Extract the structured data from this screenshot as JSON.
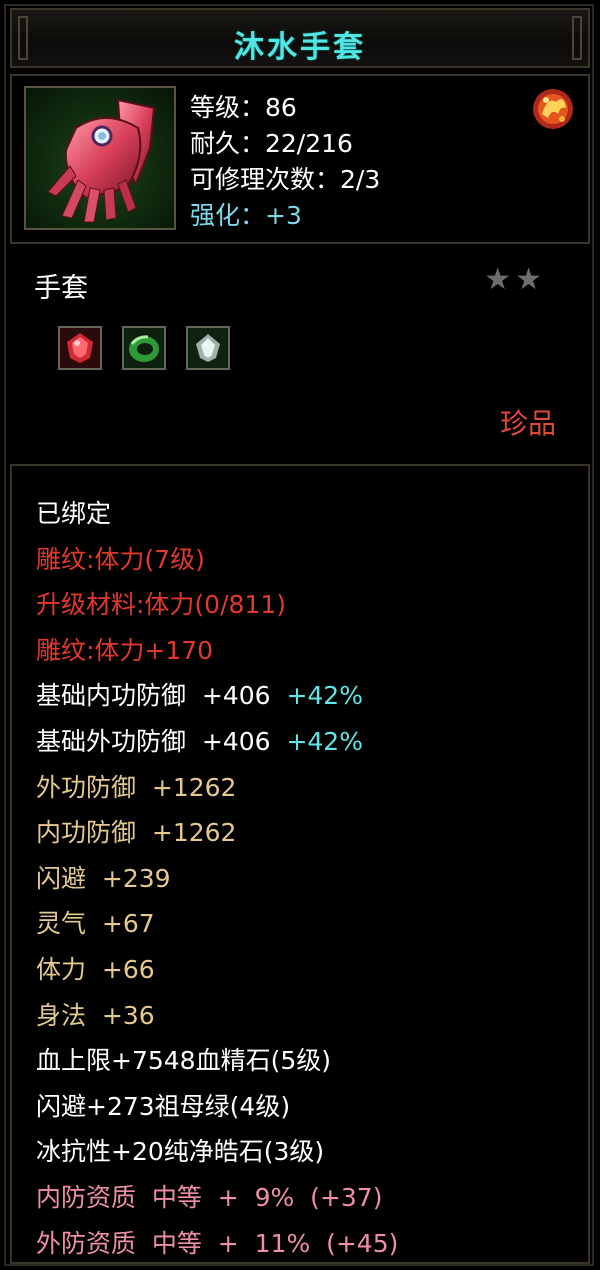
{
  "item": {
    "name": "沐水手套",
    "info": {
      "level": "等级：86",
      "durability": "耐久：22/216",
      "repair": "可修理次数：2/3",
      "enhance": "强化：+3"
    },
    "type": "手套",
    "stars": "★★",
    "rarity": "珍品",
    "icons": {
      "item": "red-gauntlet-icon",
      "emblem": "flame-emblem-icon",
      "gems": [
        "red-gem-icon",
        "green-jade-icon",
        "white-diamond-icon"
      ]
    }
  },
  "stats": [
    {
      "text": "已绑定",
      "color": "#ffffff"
    },
    {
      "text": "雕纹:体力(7级)",
      "color": "#e0392c"
    },
    {
      "text": "升级材料:体力(0/811)",
      "color": "#e0392c"
    },
    {
      "text": "雕纹:体力+170",
      "color": "#e0392c"
    },
    {
      "text": "基础内功防御  +406",
      "extra": "+42%",
      "color": "#ffffff"
    },
    {
      "text": "基础外功防御  +406",
      "extra": "+42%",
      "color": "#ffffff"
    },
    {
      "text": "外功防御  +1262",
      "color": "#e3c98d"
    },
    {
      "text": "内功防御  +1262",
      "color": "#e3c98d"
    },
    {
      "text": "闪避  +239",
      "color": "#e3c98d"
    },
    {
      "text": "灵气  +67",
      "color": "#e3c98d"
    },
    {
      "text": "体力  +66",
      "color": "#e3c98d"
    },
    {
      "text": "身法  +36",
      "color": "#e3c98d"
    },
    {
      "text": "血上限+7548血精石(5级)",
      "color": "#ffffff"
    },
    {
      "text": "闪避+273祖母绿(4级)",
      "color": "#ffffff"
    },
    {
      "text": "冰抗性+20纯净皓石(3级)",
      "color": "#ffffff"
    },
    {
      "text": "内防资质  中等  +  9%  (+37)",
      "color": "#ee8fa7"
    },
    {
      "text": "外防资质  中等  +  11%  (+45)",
      "color": "#ee8fa7"
    }
  ]
}
